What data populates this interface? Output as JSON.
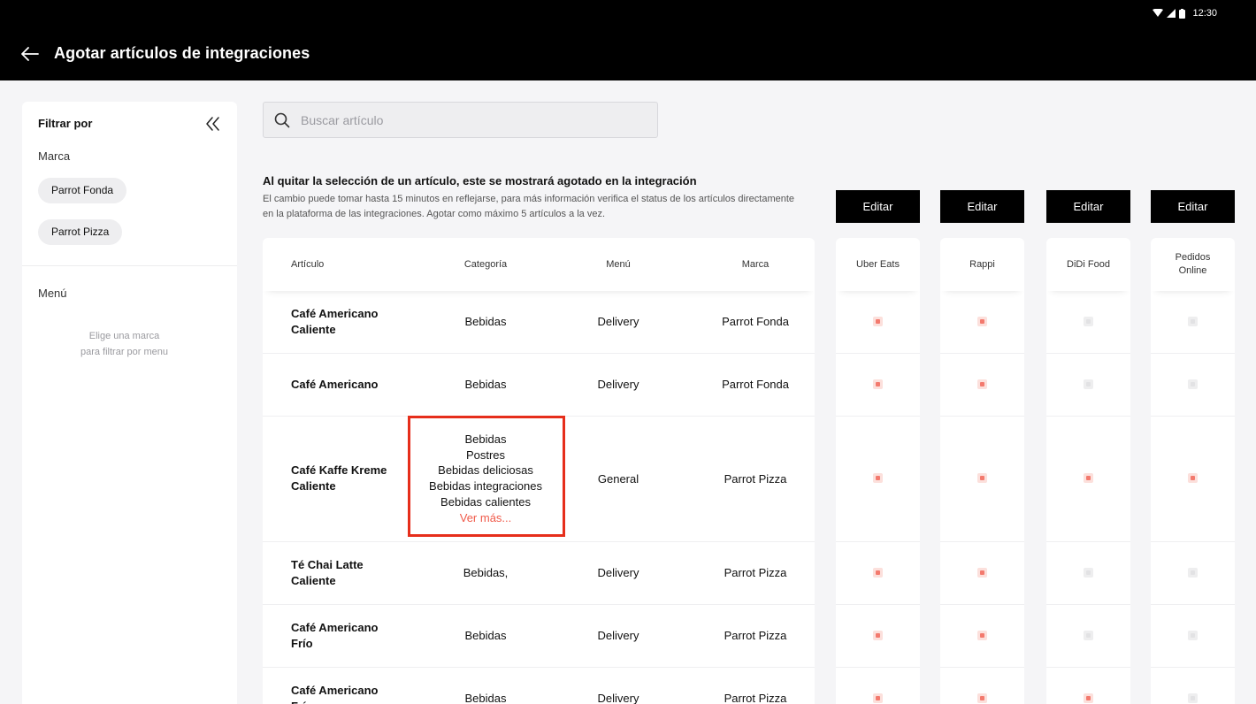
{
  "status_bar": {
    "time": "12:30"
  },
  "header": {
    "title": "Agotar artículos de integraciones"
  },
  "sidebar": {
    "filter_title": "Filtrar por",
    "brand_label": "Marca",
    "brands": [
      "Parrot Fonda",
      "Parrot Pizza"
    ],
    "menu_label": "Menú",
    "menu_hint_line1": "Elige una marca",
    "menu_hint_line2": "para filtrar por menu"
  },
  "search": {
    "placeholder": "Buscar artículo",
    "value": ""
  },
  "info": {
    "title": "Al quitar la selección de un artículo, este se mostrará agotado en la integración",
    "text": "El cambio puede tomar hasta 15 minutos en reflejarse, para más información verifica el status de los artículos directamente en la plataforma de las integraciones. Agotar como máximo 5 artículos a la vez."
  },
  "table": {
    "headers": {
      "item": "Artículo",
      "category": "Categoría",
      "menu": "Menú",
      "brand": "Marca"
    },
    "rows": [
      {
        "name": "Café Americano Caliente",
        "category": "Bebidas",
        "menu": "Delivery",
        "brand": "Parrot Fonda"
      },
      {
        "name": "Café Americano",
        "category": "Bebidas",
        "menu": "Delivery",
        "brand": "Parrot Fonda"
      },
      {
        "name": "Café Kaffe Kreme Caliente",
        "categories": [
          "Bebidas",
          "Postres",
          "Bebidas deliciosas",
          "Bebidas integraciones",
          "Bebidas calientes"
        ],
        "see_more": "Ver más...",
        "menu": "General",
        "brand": "Parrot Pizza"
      },
      {
        "name": "Té Chai Latte Caliente",
        "category": "Bebidas,",
        "menu": "Delivery",
        "brand": "Parrot Pizza"
      },
      {
        "name": "Café Americano Frío",
        "category": "Bebidas",
        "menu": "Delivery",
        "brand": "Parrot Pizza"
      },
      {
        "name": "Café Americano Frío",
        "category": "Bebidas",
        "menu": "Delivery",
        "brand": "Parrot Pizza"
      }
    ]
  },
  "integrations": [
    {
      "name": "Uber Eats",
      "edit_label": "Editar",
      "checks": [
        true,
        true,
        true,
        true,
        true,
        true
      ]
    },
    {
      "name": "Rappi",
      "edit_label": "Editar",
      "checks": [
        true,
        true,
        true,
        true,
        true,
        true
      ]
    },
    {
      "name": "DiDi Food",
      "edit_label": "Editar",
      "checks": [
        false,
        false,
        true,
        false,
        false,
        true
      ]
    },
    {
      "name": "Pedidos Online",
      "edit_label": "Editar",
      "checks": [
        false,
        false,
        true,
        false,
        false,
        false
      ]
    }
  ],
  "colors": {
    "accent": "#f05a4a",
    "highlight": "#e62e1b",
    "checked": "#f37a6e",
    "header_bg": "#000000"
  }
}
